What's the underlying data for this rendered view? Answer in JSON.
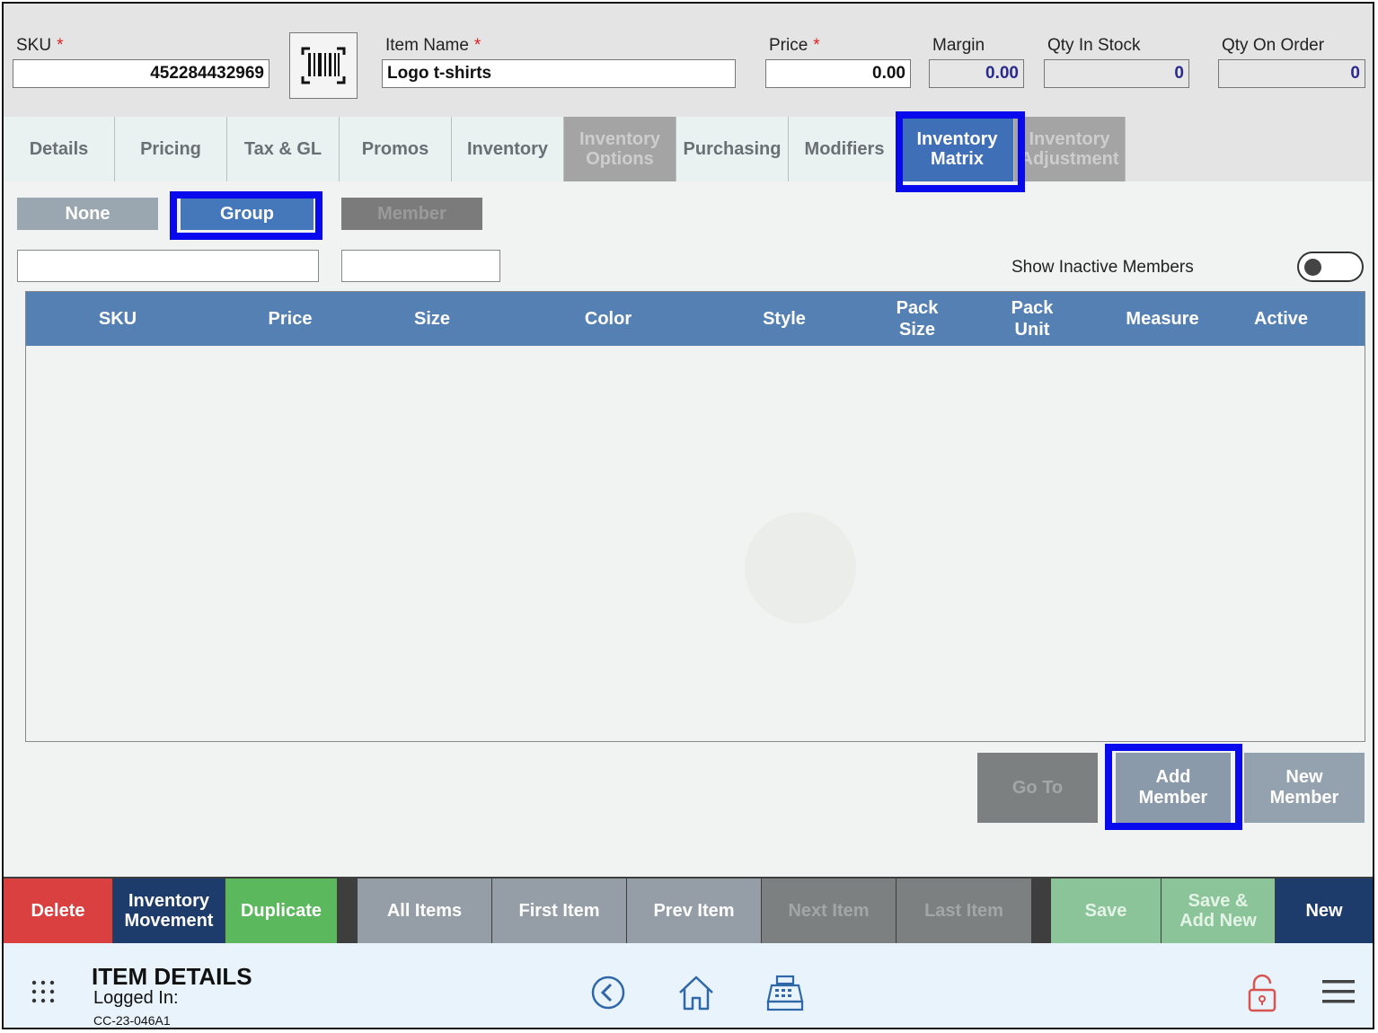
{
  "header": {
    "sku": {
      "label": "SKU",
      "value": "452284432969"
    },
    "item_name": {
      "label": "Item Name",
      "value": "Logo t-shirts"
    },
    "price": {
      "label": "Price",
      "value": "0.00"
    },
    "margin": {
      "label": "Margin",
      "value": "0.00"
    },
    "qty_in_stock": {
      "label": "Qty In Stock",
      "value": "0"
    },
    "qty_on_order": {
      "label": "Qty On Order",
      "value": "0"
    },
    "required_mark": "*"
  },
  "tabs": [
    {
      "label": "Details",
      "state": "normal"
    },
    {
      "label": "Pricing",
      "state": "normal"
    },
    {
      "label": "Tax & GL",
      "state": "normal"
    },
    {
      "label": "Promos",
      "state": "normal"
    },
    {
      "label": "Inventory",
      "state": "normal"
    },
    {
      "label": "Inventory\nOptions",
      "state": "disabled"
    },
    {
      "label": "Purchasing",
      "state": "normal"
    },
    {
      "label": "Modifiers",
      "state": "normal"
    },
    {
      "label": "Inventory\nMatrix",
      "state": "active"
    },
    {
      "label": "Inventory\nAdjustment",
      "state": "disabled"
    }
  ],
  "matrix_modes": {
    "none": "None",
    "group": "Group",
    "member": "Member",
    "selected": "Group"
  },
  "show_inactive_label": "Show Inactive Members",
  "show_inactive_on": false,
  "grid_columns": [
    "SKU",
    "Price",
    "Size",
    "Color",
    "Style",
    "Pack\nSize",
    "Pack\nUnit",
    "Measure",
    "Active"
  ],
  "actions": {
    "go_to": "Go To",
    "add_member": "Add\nMember",
    "new_member": "New\nMember"
  },
  "toolbar": {
    "delete": "Delete",
    "inventory_movement": "Inventory\nMovement",
    "duplicate": "Duplicate",
    "all_items": "All Items",
    "first_item": "First Item",
    "prev_item": "Prev Item",
    "next_item": "Next Item",
    "last_item": "Last Item",
    "save": "Save",
    "save_add_new": "Save &\nAdd New",
    "new": "New"
  },
  "footer": {
    "title": "ITEM DETAILS",
    "logged_in": "Logged In:",
    "station": "CC-23-046A1"
  },
  "icons": [
    "barcode-icon",
    "apps-grid-icon",
    "back-icon",
    "home-icon",
    "register-icon",
    "lock-icon",
    "menu-icon"
  ],
  "colors": {
    "active_tab": "#3e6fb7",
    "grid_header": "#5580b4",
    "highlight": "#0909ee",
    "delete": "#d9403f",
    "navy": "#1d3c6b",
    "green": "#5cb85c",
    "light_green": "#8cc49a"
  }
}
